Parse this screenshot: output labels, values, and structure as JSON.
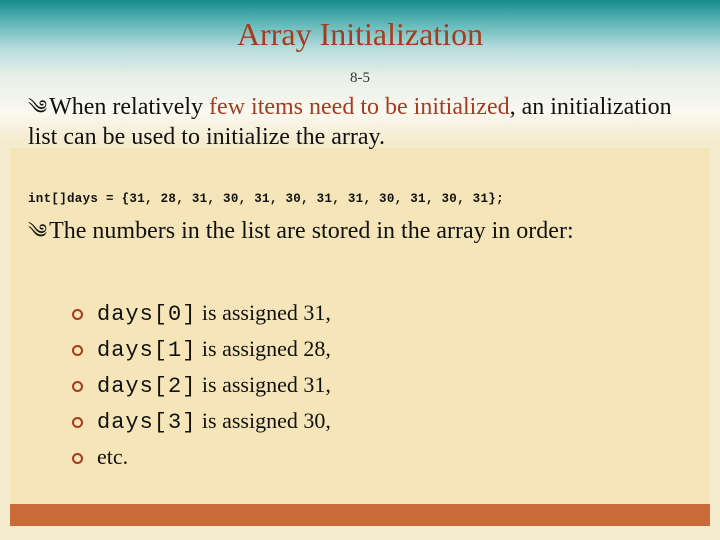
{
  "title": "Array Initialization",
  "page_number": "8-5",
  "para1": {
    "bullet": "༄",
    "pre": "When relatively ",
    "emph": "few items need to be initialized",
    "post": ", an initialization list can be used to initialize the array."
  },
  "code": "int[]days = {31, 28, 31, 30, 31, 30, 31, 31, 30, 31, 30, 31};",
  "para2": {
    "bullet": "༄",
    "text": "The numbers in the list are stored in the array in order:"
  },
  "sublist": [
    {
      "mono": "days[0]",
      "rest": " is assigned 31,"
    },
    {
      "mono": "days[1]",
      "rest": " is assigned 28,"
    },
    {
      "mono": "days[2]",
      "rest": " is assigned 31,"
    },
    {
      "mono": "days[3]",
      "rest": " is assigned 30,"
    },
    {
      "mono": "",
      "rest": "etc."
    }
  ]
}
